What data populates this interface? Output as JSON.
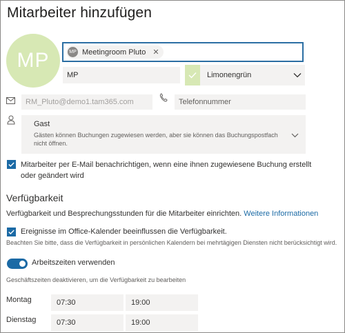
{
  "header": {
    "title": "Mitarbeiter hinzufügen"
  },
  "avatar": {
    "initials": "MP",
    "color": "#d7e8b4"
  },
  "name_input": {
    "chip_initials": "MP",
    "chip_label": "Meetingroom Pluto"
  },
  "initials_field": {
    "value": "MP"
  },
  "color_select": {
    "selected": "Limonengrün",
    "swatch_color": "#d7e8b4"
  },
  "email_field": {
    "value": "RM_Pluto@demo1.tam365.com"
  },
  "phone_field": {
    "placeholder": "Telefonnummer"
  },
  "role_select": {
    "selected": "Gast",
    "description": "Gästen können Buchungen zugewiesen werden, aber sie können das Buchungspostfach nicht öffnen."
  },
  "notify_checkbox": {
    "checked": true,
    "label": "Mitarbeiter per E-Mail benachrichtigen, wenn eine ihnen zugewiesene Buchung erstellt oder geändert wird"
  },
  "availability": {
    "title": "Verfügbarkeit",
    "description": "Verfügbarkeit und Besprechungsstunden für die Mitarbeiter einrichten.",
    "link": "Weitere Informationen",
    "calendar_checkbox": {
      "checked": true,
      "label": "Ereignisse im Office-Kalender beeinflussen die Verfügbarkeit."
    },
    "note": "Beachten Sie bitte, dass die Verfügbarkeit in persönlichen Kalendern bei mehrtägigen Diensten nicht berücksichtigt wird.",
    "working_hours_toggle": {
      "on": true,
      "label": "Arbeitszeiten verwenden"
    },
    "toggle_note": "Geschäftszeiten deaktivieren, um die Verfügbarkeit zu bearbeiten",
    "days": [
      {
        "day": "Montag",
        "start": "07:30",
        "end": "19:00"
      },
      {
        "day": "Dienstag",
        "start": "07:30",
        "end": "19:00"
      }
    ]
  },
  "colors": {
    "accent": "#1b6aa5",
    "focus_border": "#2b6ea3",
    "field_bg": "#f3f2f1"
  }
}
